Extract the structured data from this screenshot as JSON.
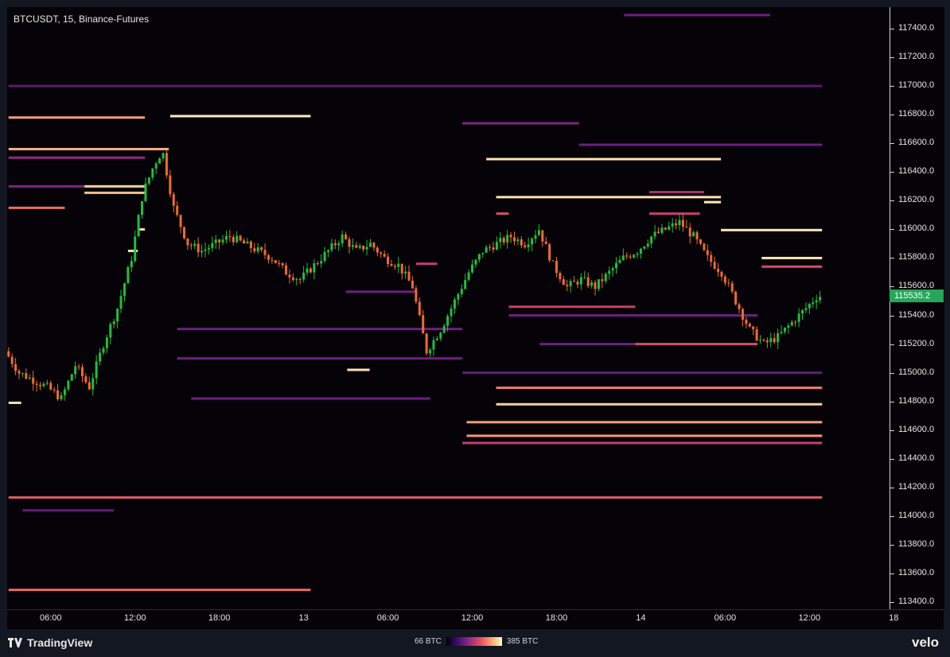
{
  "header": {
    "symbol": "BTCUSDT, 15, Binance-Futures"
  },
  "footer": {
    "brand": "TradingView",
    "legend_min": "66 BTC",
    "legend_max": "385 BTC",
    "provider": "velo"
  },
  "colors": {
    "up": "#1fbf3b",
    "down": "#f26a2a",
    "price_tag": "#26a65b"
  },
  "chart_data": {
    "type": "candlestick-heatmap",
    "title": "BTCUSDT, 15, Binance-Futures",
    "ylim": [
      113350,
      117550
    ],
    "y_ticks": [
      117400,
      117200,
      117000,
      116800,
      116600,
      116400,
      116200,
      116000,
      115800,
      115600,
      115400,
      115200,
      115000,
      114800,
      114600,
      114400,
      114200,
      114000,
      113800,
      113600,
      113400
    ],
    "x_ticks": [
      "06:00",
      "12:00",
      "18:00",
      "13",
      "06:00",
      "12:00",
      "18:00",
      "14",
      "06:00",
      "12:00",
      "18"
    ],
    "x_tick_hours": [
      6,
      12,
      18,
      24,
      30,
      36,
      42,
      48,
      54,
      60,
      66
    ],
    "xlim_hours": [
      2.9,
      65.7
    ],
    "last_price": "115535.2",
    "price_path": [
      [
        3.0,
        115150
      ],
      [
        4.0,
        115000
      ],
      [
        5.0,
        114950
      ],
      [
        6.0,
        114900
      ],
      [
        7.0,
        114820
      ],
      [
        8.0,
        115050
      ],
      [
        9.0,
        114900
      ],
      [
        10.0,
        115200
      ],
      [
        11.0,
        115450
      ],
      [
        12.0,
        115800
      ],
      [
        12.8,
        116250
      ],
      [
        13.6,
        116450
      ],
      [
        14.2,
        116550
      ],
      [
        15.0,
        116150
      ],
      [
        16.0,
        115900
      ],
      [
        17.0,
        115850
      ],
      [
        18.0,
        115900
      ],
      [
        19.0,
        115950
      ],
      [
        20.0,
        115900
      ],
      [
        21.0,
        115850
      ],
      [
        22.0,
        115800
      ],
      [
        23.0,
        115700
      ],
      [
        24.0,
        115650
      ],
      [
        25.0,
        115750
      ],
      [
        26.0,
        115850
      ],
      [
        27.0,
        115950
      ],
      [
        28.0,
        115850
      ],
      [
        29.0,
        115900
      ],
      [
        30.0,
        115800
      ],
      [
        31.0,
        115750
      ],
      [
        32.0,
        115600
      ],
      [
        33.0,
        115150
      ],
      [
        34.0,
        115300
      ],
      [
        35.0,
        115500
      ],
      [
        36.0,
        115700
      ],
      [
        37.0,
        115850
      ],
      [
        38.0,
        115900
      ],
      [
        39.0,
        115950
      ],
      [
        40.0,
        115900
      ],
      [
        41.0,
        116000
      ],
      [
        42.0,
        115750
      ],
      [
        43.0,
        115600
      ],
      [
        44.0,
        115650
      ],
      [
        45.0,
        115600
      ],
      [
        46.0,
        115700
      ],
      [
        47.0,
        115800
      ],
      [
        48.0,
        115850
      ],
      [
        49.0,
        115950
      ],
      [
        50.0,
        116000
      ],
      [
        51.0,
        116050
      ],
      [
        52.0,
        115950
      ],
      [
        53.0,
        115800
      ],
      [
        54.0,
        115700
      ],
      [
        55.0,
        115500
      ],
      [
        56.0,
        115300
      ],
      [
        57.0,
        115200
      ],
      [
        58.0,
        115250
      ],
      [
        59.0,
        115350
      ],
      [
        60.0,
        115450
      ],
      [
        60.8,
        115535
      ]
    ],
    "liquidity_levels": [
      {
        "price": 116780,
        "from": 3.0,
        "to": 12.7,
        "intensity": 0.82
      },
      {
        "price": 116790,
        "from": 14.5,
        "to": 24.5,
        "intensity": 0.97
      },
      {
        "price": 116560,
        "from": 3.0,
        "to": 14.4,
        "intensity": 0.85
      },
      {
        "price": 116500,
        "from": 3.0,
        "to": 12.7,
        "intensity": 0.4
      },
      {
        "price": 116300,
        "from": 8.4,
        "to": 12.7,
        "intensity": 0.92
      },
      {
        "price": 116255,
        "from": 8.4,
        "to": 12.7,
        "intensity": 0.88
      },
      {
        "price": 116300,
        "from": 3.0,
        "to": 8.4,
        "intensity": 0.35
      },
      {
        "price": 116150,
        "from": 3.0,
        "to": 7.0,
        "intensity": 0.72
      },
      {
        "price": 116000,
        "from": 12.2,
        "to": 12.7,
        "intensity": 0.95
      },
      {
        "price": 115850,
        "from": 11.5,
        "to": 12.2,
        "intensity": 0.95
      },
      {
        "price": 116490,
        "from": 37.0,
        "to": 53.7,
        "intensity": 0.96
      },
      {
        "price": 116225,
        "from": 37.7,
        "to": 53.7,
        "intensity": 0.95
      },
      {
        "price": 116190,
        "from": 52.5,
        "to": 53.7,
        "intensity": 0.97
      },
      {
        "price": 116260,
        "from": 48.6,
        "to": 52.5,
        "intensity": 0.45
      },
      {
        "price": 116110,
        "from": 37.7,
        "to": 38.6,
        "intensity": 0.6
      },
      {
        "price": 116110,
        "from": 48.6,
        "to": 52.2,
        "intensity": 0.55
      },
      {
        "price": 115995,
        "from": 53.7,
        "to": 60.9,
        "intensity": 0.97
      },
      {
        "price": 115800,
        "from": 56.6,
        "to": 60.9,
        "intensity": 0.96
      },
      {
        "price": 115740,
        "from": 56.6,
        "to": 60.9,
        "intensity": 0.6
      },
      {
        "price": 116740,
        "from": 35.3,
        "to": 43.6,
        "intensity": 0.35
      },
      {
        "price": 116590,
        "from": 43.6,
        "to": 60.9,
        "intensity": 0.3
      },
      {
        "price": 117495,
        "from": 46.8,
        "to": 57.2,
        "intensity": 0.3
      },
      {
        "price": 117000,
        "from": 3.0,
        "to": 60.9,
        "intensity": 0.22
      },
      {
        "price": 115200,
        "from": 47.6,
        "to": 56.3,
        "intensity": 0.6
      },
      {
        "price": 115200,
        "from": 40.8,
        "to": 47.6,
        "intensity": 0.3
      },
      {
        "price": 115020,
        "from": 27.1,
        "to": 28.7,
        "intensity": 0.95
      },
      {
        "price": 114895,
        "from": 37.7,
        "to": 60.9,
        "intensity": 0.75
      },
      {
        "price": 114780,
        "from": 37.7,
        "to": 60.9,
        "intensity": 0.92
      },
      {
        "price": 114655,
        "from": 35.6,
        "to": 60.9,
        "intensity": 0.82
      },
      {
        "price": 114560,
        "from": 35.6,
        "to": 60.9,
        "intensity": 0.8
      },
      {
        "price": 114510,
        "from": 35.3,
        "to": 60.9,
        "intensity": 0.55
      },
      {
        "price": 115000,
        "from": 35.3,
        "to": 60.9,
        "intensity": 0.25
      },
      {
        "price": 115305,
        "from": 15.0,
        "to": 35.3,
        "intensity": 0.3
      },
      {
        "price": 115100,
        "from": 15.0,
        "to": 35.3,
        "intensity": 0.3
      },
      {
        "price": 114820,
        "from": 16.0,
        "to": 33.0,
        "intensity": 0.3
      },
      {
        "price": 114130,
        "from": 3.0,
        "to": 60.9,
        "intensity": 0.65
      },
      {
        "price": 113485,
        "from": 3.0,
        "to": 24.5,
        "intensity": 0.7
      },
      {
        "price": 115565,
        "from": 27.0,
        "to": 32.0,
        "intensity": 0.3
      },
      {
        "price": 115460,
        "from": 38.6,
        "to": 47.6,
        "intensity": 0.55
      },
      {
        "price": 115400,
        "from": 38.6,
        "to": 56.3,
        "intensity": 0.3
      },
      {
        "price": 115760,
        "from": 32.0,
        "to": 33.5,
        "intensity": 0.55
      },
      {
        "price": 114790,
        "from": 3.0,
        "to": 3.9,
        "intensity": 0.95
      },
      {
        "price": 114040,
        "from": 4.0,
        "to": 10.5,
        "intensity": 0.25
      }
    ]
  }
}
